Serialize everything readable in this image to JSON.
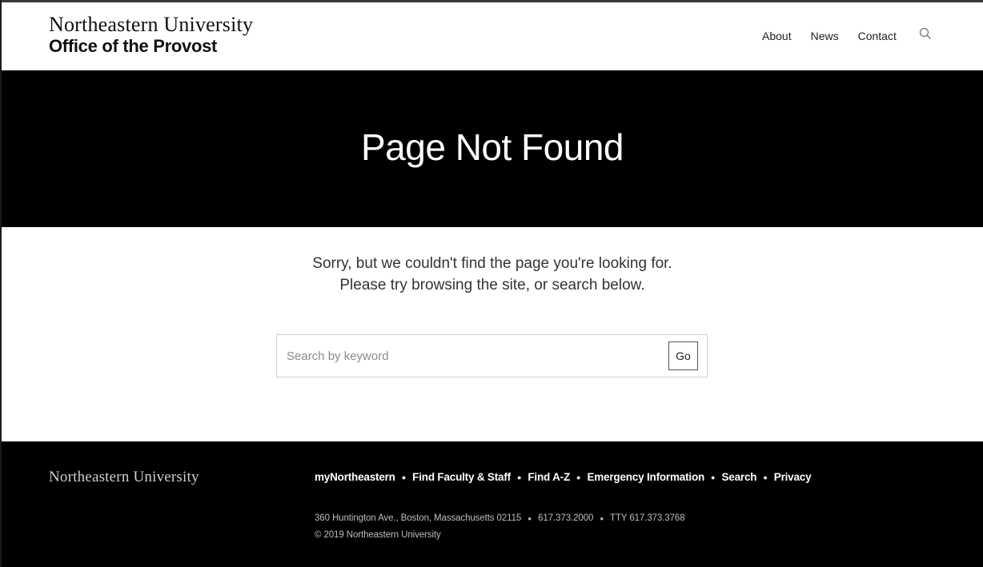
{
  "header": {
    "logo_university": "Northeastern University",
    "logo_office": "Office of the Provost",
    "nav": [
      {
        "label": "About"
      },
      {
        "label": "News"
      },
      {
        "label": "Contact"
      }
    ],
    "search_icon": "search-icon"
  },
  "hero": {
    "title": "Page Not Found"
  },
  "main": {
    "message_line1": "Sorry, but we couldn't find the page you're looking for.",
    "message_line2": "Please try browsing the site, or search below.",
    "search": {
      "placeholder": "Search by keyword",
      "value": "",
      "button_label": "Go"
    }
  },
  "footer": {
    "logo": "Northeastern University",
    "links": [
      {
        "label": "myNortheastern"
      },
      {
        "label": "Find Faculty & Staff"
      },
      {
        "label": "Find A-Z"
      },
      {
        "label": "Emergency Information"
      },
      {
        "label": "Search"
      },
      {
        "label": "Privacy"
      }
    ],
    "separator": "●",
    "address": "360 Huntington Ave., Boston, Massachusetts 02115",
    "phone": "617.373.2000",
    "tty": "TTY 617.373.3768",
    "copyright": "© 2019 Northeastern University"
  },
  "colors": {
    "hero_bg": "#000000",
    "footer_bg": "#000000",
    "text": "#222222"
  }
}
